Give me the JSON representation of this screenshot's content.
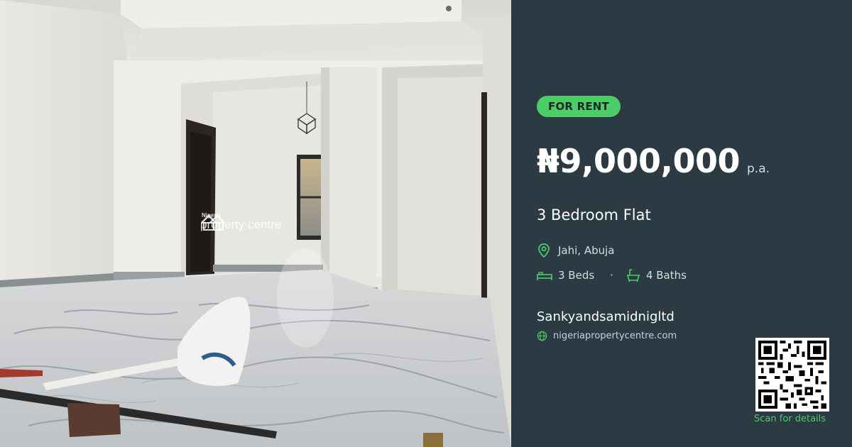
{
  "photo": {
    "alt": "Empty unfurnished room with marble tiled floor and construction debris",
    "watermark_small": "Nigeria",
    "watermark_big": "property centre"
  },
  "listing": {
    "badge": "FOR RENT",
    "price": "₦9,000,000",
    "period": "p.a.",
    "title": "3 Bedroom Flat",
    "location": "Jahi, Abuja",
    "beds": "3 Beds",
    "separator": "·",
    "baths": "4 Baths"
  },
  "agent": {
    "name": "Sankyandsamidnigltd",
    "website": "nigeriapropertycentre.com"
  },
  "qr": {
    "caption": "Scan for details"
  },
  "colors": {
    "panel_bg": "#2c3a44",
    "accent_green": "#4ccd6a",
    "text_primary": "#ffffff",
    "text_secondary": "#d6dde2"
  },
  "icons": {
    "location": "map-pin-icon",
    "beds": "bed-icon",
    "baths": "bathtub-icon",
    "website": "globe-icon"
  }
}
